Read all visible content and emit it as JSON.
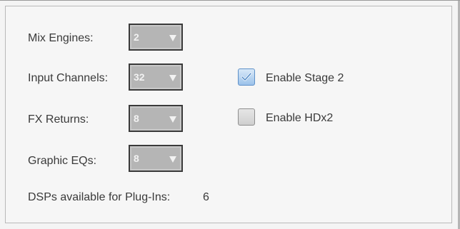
{
  "engine": {
    "mix_engines": {
      "label": "Mix Engines:",
      "value": "2"
    },
    "input_channels": {
      "label": "Input Channels:",
      "value": "32"
    },
    "fx_returns": {
      "label": "FX Returns:",
      "value": "8"
    },
    "graphic_eqs": {
      "label": "Graphic EQs:",
      "value": "8"
    }
  },
  "options": {
    "stage2": {
      "label": "Enable Stage 2",
      "checked": true
    },
    "hdx2": {
      "label": "Enable HDx2",
      "checked": false
    }
  },
  "dsp": {
    "label": "DSPs available for Plug-Ins:",
    "value": "6"
  },
  "icons": {
    "dropdown": "chevron-down-icon",
    "check": "checkmark-icon"
  },
  "colors": {
    "select_bg": "#b5b5b5",
    "select_border": "#3a3a3a",
    "check_blue": "#5d90c8"
  }
}
